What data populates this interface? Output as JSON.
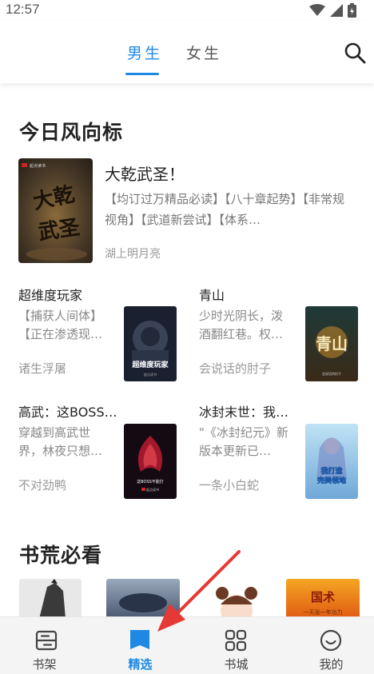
{
  "status": {
    "time": "12:57"
  },
  "tabs": {
    "male": "男生",
    "female": "女生"
  },
  "sections": {
    "wind_vane": "今日风向标",
    "must_read": "书荒必看"
  },
  "featured": {
    "title": "大乾武圣！",
    "desc": "【均订过万精品必读】【八十章起势】【非常规视角】【武道新尝试】【体系…",
    "author": "湖上明月亮",
    "cover_text": "大乾武圣"
  },
  "books": [
    {
      "title": "超维度玩家",
      "desc": "【捕获人间体】【正在渗透现…",
      "author": "诸生浮屠",
      "cover_text": "超维度玩家"
    },
    {
      "title": "青山",
      "desc": "少时光阴长，泼酒翻红巷。权…",
      "author": "会说话的肘子",
      "cover_text": "青山"
    },
    {
      "title": "高武：这BOSS…",
      "desc": "穿越到高武世界，林夜只想…",
      "author": "不对劲鸭",
      "cover_text": "这BOSS不能打"
    },
    {
      "title": "冰封末世：我…",
      "desc": "\"《冰封纪元》新版本更新已…",
      "author": "一条小白蛇",
      "cover_text": "我打造完美领地"
    }
  ],
  "strip": {
    "book4_text": "国术",
    "book4_sub": "一天涨一年功力"
  },
  "nav": {
    "shelf": "书架",
    "featured": "精选",
    "store": "书城",
    "me": "我的"
  },
  "colors": {
    "accent": "#1e88e5",
    "arrow": "#e53935"
  }
}
